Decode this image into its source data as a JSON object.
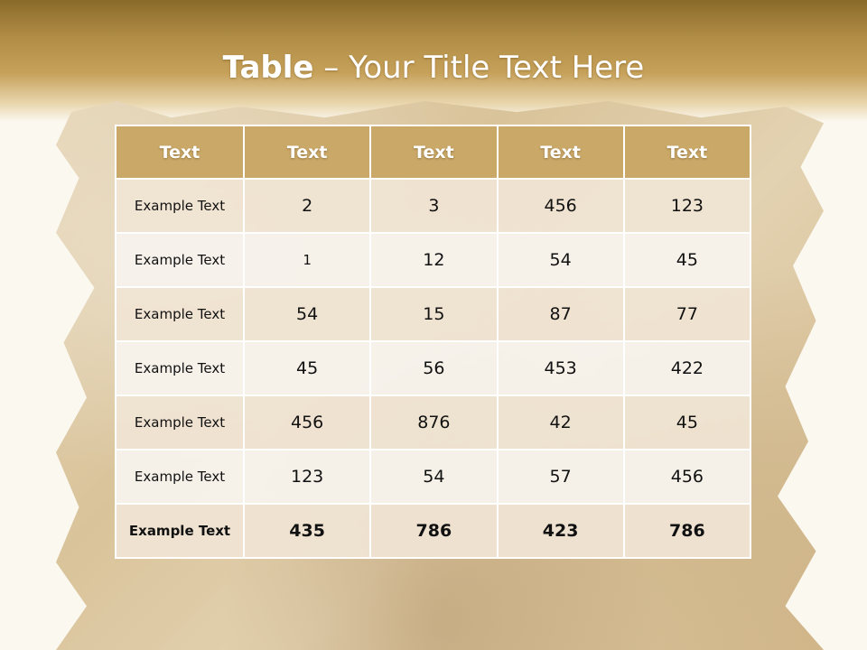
{
  "title": {
    "bold": "Table",
    "rest": " – Your Title Text Here"
  },
  "table": {
    "headers": [
      "Text",
      "Text",
      "Text",
      "Text",
      "Text"
    ],
    "rows": [
      [
        "Example Text",
        "2",
        "3",
        "456",
        "123"
      ],
      [
        "Example Text",
        "1",
        "12",
        "54",
        "45"
      ],
      [
        "Example Text",
        "54",
        "15",
        "87",
        "77"
      ],
      [
        "Example Text",
        "45",
        "56",
        "453",
        "422"
      ],
      [
        "Example Text",
        "456",
        "876",
        "42",
        "45"
      ],
      [
        "Example Text",
        "123",
        "54",
        "57",
        "456"
      ],
      [
        "Example Text",
        "435",
        "786",
        "423",
        "786"
      ]
    ]
  },
  "colors": {
    "header": "#c9a868",
    "band": "#b08c45",
    "row_odd": "#f0e4d4",
    "row_even": "#f7f3ed"
  }
}
